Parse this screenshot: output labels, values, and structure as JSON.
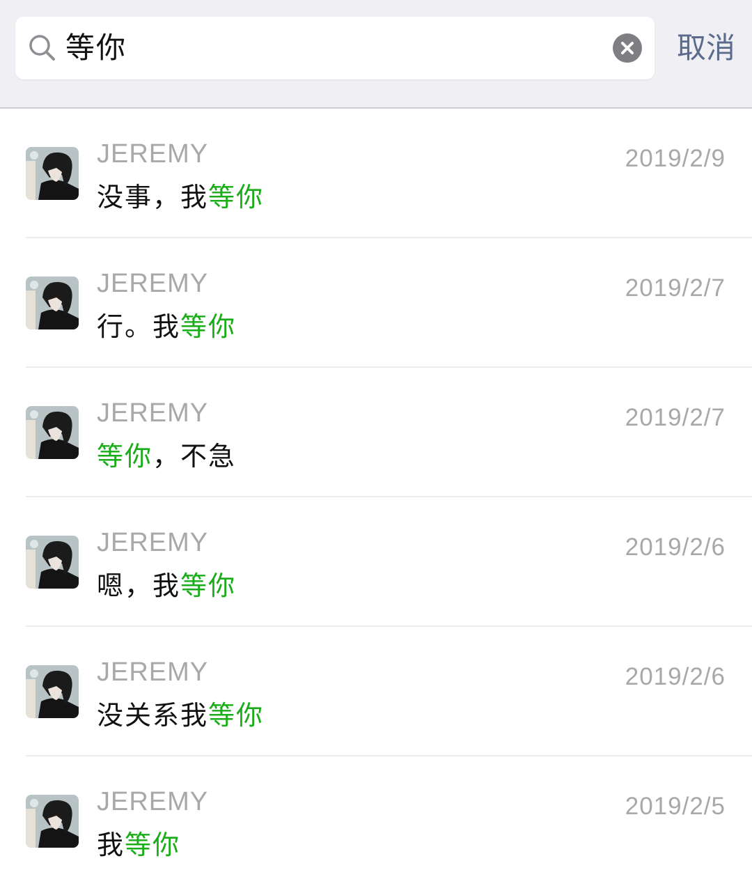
{
  "search": {
    "query": "等你",
    "cancel_label": "取消"
  },
  "results": [
    {
      "name": "JEREMY",
      "date": "2019/2/9",
      "before": "没事，我",
      "match": "等你",
      "after": ""
    },
    {
      "name": "JEREMY",
      "date": "2019/2/7",
      "before": "行。我",
      "match": "等你",
      "after": ""
    },
    {
      "name": "JEREMY",
      "date": "2019/2/7",
      "before": "",
      "match": "等你",
      "after": "，不急"
    },
    {
      "name": "JEREMY",
      "date": "2019/2/6",
      "before": "嗯，我",
      "match": "等你",
      "after": ""
    },
    {
      "name": "JEREMY",
      "date": "2019/2/6",
      "before": "没关系我",
      "match": "等你",
      "after": ""
    },
    {
      "name": "JEREMY",
      "date": "2019/2/5",
      "before": "我",
      "match": "等你",
      "after": ""
    }
  ],
  "colors": {
    "highlight": "#1aad19",
    "cancel": "#5b6b8c",
    "meta_text": "#a8a8a8"
  }
}
